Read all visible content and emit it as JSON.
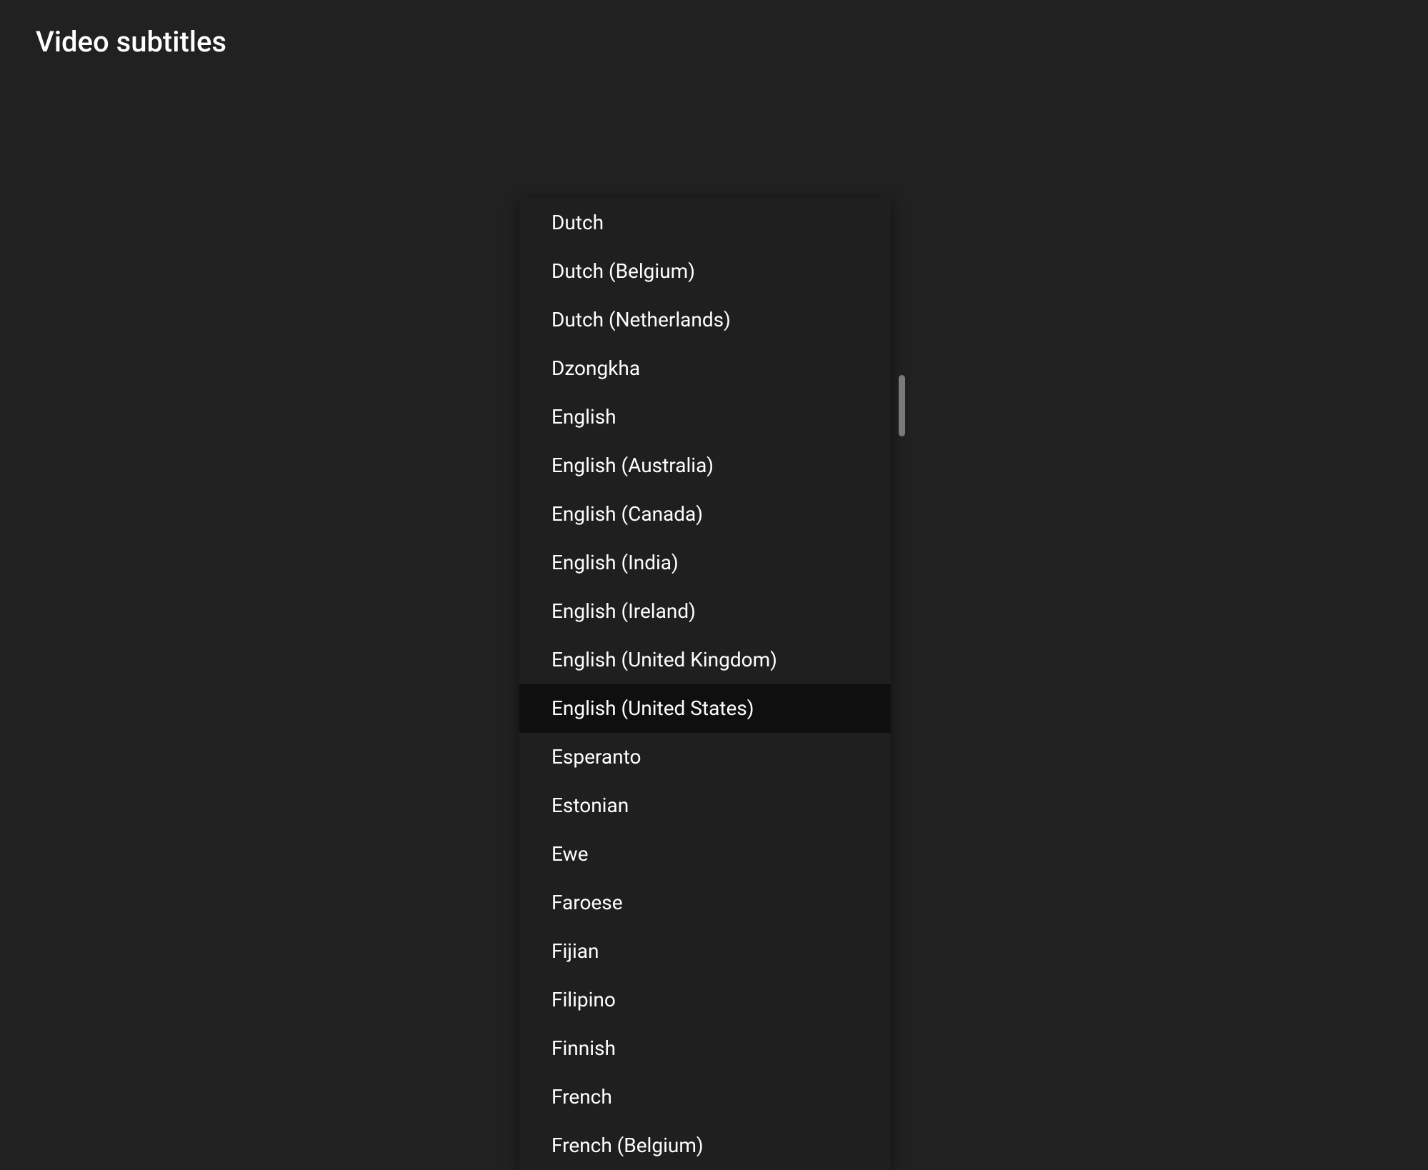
{
  "header": {
    "title": "Video subtitles"
  },
  "languages": [
    {
      "label": "Dutch",
      "selected": false
    },
    {
      "label": "Dutch (Belgium)",
      "selected": false
    },
    {
      "label": "Dutch (Netherlands)",
      "selected": false
    },
    {
      "label": "Dzongkha",
      "selected": false
    },
    {
      "label": "English",
      "selected": false
    },
    {
      "label": "English (Australia)",
      "selected": false
    },
    {
      "label": "English (Canada)",
      "selected": false
    },
    {
      "label": "English (India)",
      "selected": false
    },
    {
      "label": "English (Ireland)",
      "selected": false
    },
    {
      "label": "English (United Kingdom)",
      "selected": false
    },
    {
      "label": "English (United States)",
      "selected": true
    },
    {
      "label": "Esperanto",
      "selected": false
    },
    {
      "label": "Estonian",
      "selected": false
    },
    {
      "label": "Ewe",
      "selected": false
    },
    {
      "label": "Faroese",
      "selected": false
    },
    {
      "label": "Fijian",
      "selected": false
    },
    {
      "label": "Filipino",
      "selected": false
    },
    {
      "label": "Finnish",
      "selected": false
    },
    {
      "label": "French",
      "selected": false
    },
    {
      "label": "French (Belgium)",
      "selected": false
    }
  ]
}
